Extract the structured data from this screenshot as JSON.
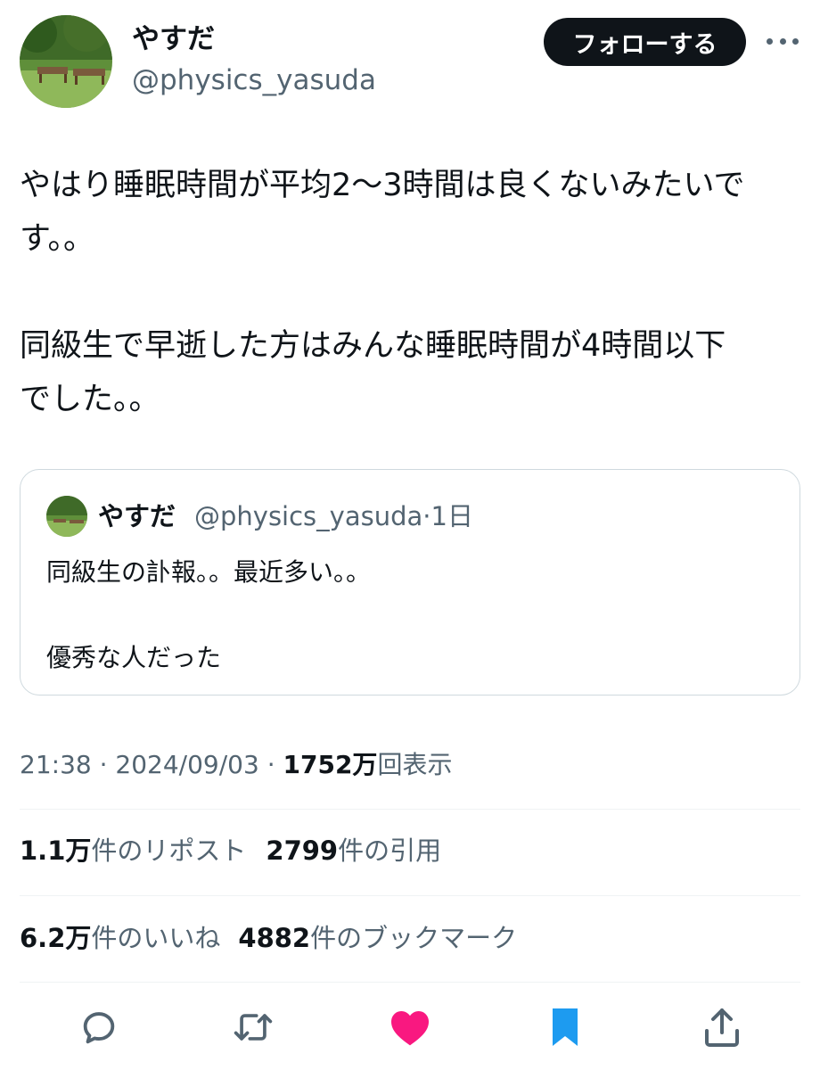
{
  "author": {
    "name": "やすだ",
    "handle": "@physics_yasuda"
  },
  "follow_button": "フォローする",
  "tweet": {
    "text": "やはり睡眠時間が平均2〜3時間は良くないみたいで\nす。。\n\n同級生で早逝した方はみんな睡眠時間が4時間以下\nでした。。"
  },
  "quote": {
    "name": "やすだ",
    "handle": "@physics_yasuda",
    "separator": "·",
    "age": "1日",
    "text": "同級生の訃報。。最近多い。。\n\n優秀な人だった"
  },
  "meta": {
    "time": "21:38",
    "sep1": " · ",
    "date": "2024/09/03",
    "sep2": " · ",
    "views": "1752万",
    "views_label": "回表示"
  },
  "stats": {
    "reposts": "1.1万",
    "reposts_label": "件のリポスト",
    "quotes": "2799",
    "quotes_label": "件の引用",
    "likes": "6.2万",
    "likes_label": "件のいいね",
    "bookmarks": "4882",
    "bookmarks_label": "件のブックマーク"
  },
  "actions": [
    "reply-icon",
    "repost-icon",
    "like-icon",
    "bookmark-icon",
    "share-icon"
  ],
  "colors": {
    "like": "#f91880",
    "bookmark": "#1d9bf0",
    "icon": "#536471",
    "text": "#0f1419"
  }
}
